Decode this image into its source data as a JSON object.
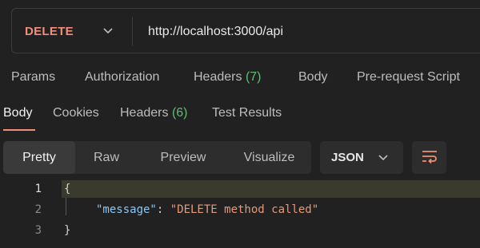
{
  "request": {
    "method": "DELETE",
    "url": "http://localhost:3000/api"
  },
  "request_tabs": {
    "params": "Params",
    "authorization": "Authorization",
    "headers": "Headers",
    "headers_count": "(7)",
    "body": "Body",
    "prerequest": "Pre-request Script"
  },
  "response_tabs": {
    "body": "Body",
    "cookies": "Cookies",
    "headers": "Headers",
    "headers_count": "(6)",
    "test_results": "Test Results"
  },
  "view_modes": {
    "pretty": "Pretty",
    "raw": "Raw",
    "preview": "Preview",
    "visualize": "Visualize",
    "selected": "Pretty"
  },
  "format": {
    "selected": "JSON"
  },
  "editor": {
    "line_numbers": [
      "1",
      "2",
      "3"
    ],
    "open_brace": "{",
    "key": "\"message\"",
    "colon": ": ",
    "value": "\"DELETE method called\"",
    "close_brace": "}"
  },
  "colors": {
    "method": "#f08e7a",
    "count": "#5fbf6f",
    "json_key": "#8ec6f0",
    "json_string": "#e49a7a",
    "accent_underline": "#f08e7a"
  },
  "icons": [
    "chevron-down-icon",
    "wrap-lines-icon"
  ]
}
